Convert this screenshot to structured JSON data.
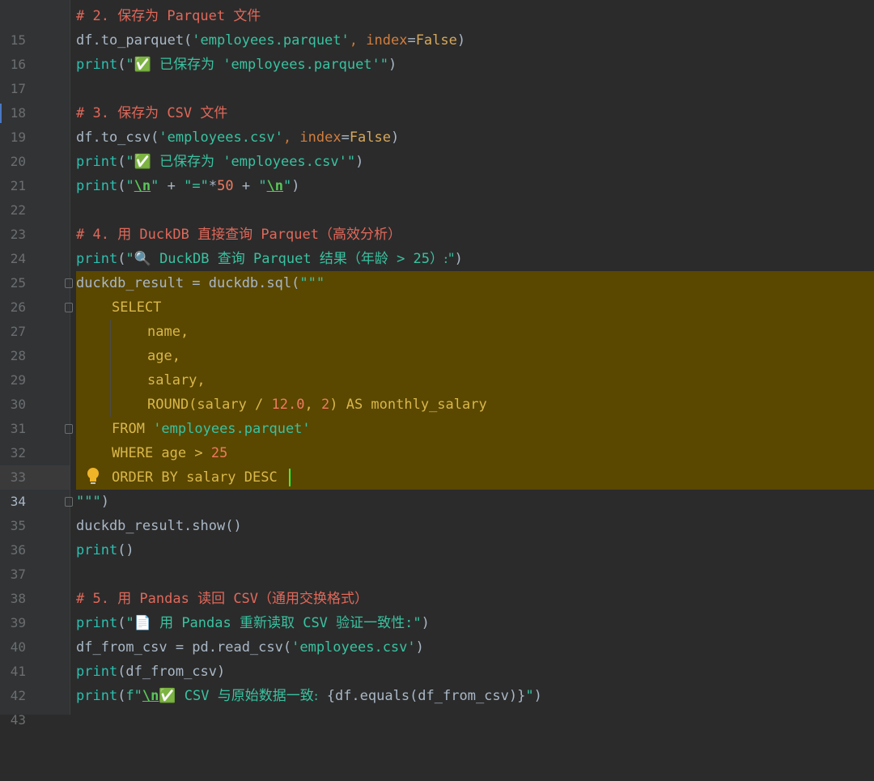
{
  "editor": {
    "current_line": "34",
    "lines": [
      {
        "n": "15",
        "text": "# 2. 保存为 Parquet 文件"
      },
      {
        "n": "16",
        "text": "df.to_parquet('employees.parquet', index=False)"
      },
      {
        "n": "17",
        "text": "print(\"✅ 已保存为 'employees.parquet'\")"
      },
      {
        "n": "18",
        "text": ""
      },
      {
        "n": "19",
        "text": "# 3. 保存为 CSV 文件"
      },
      {
        "n": "20",
        "text": "df.to_csv('employees.csv', index=False)"
      },
      {
        "n": "21",
        "text": "print(\"✅ 已保存为 'employees.csv'\")"
      },
      {
        "n": "22",
        "text": "print(\"\\n\" + \"=\"*50 + \"\\n\")"
      },
      {
        "n": "23",
        "text": ""
      },
      {
        "n": "24",
        "text": "# 4. 用 DuckDB 直接查询 Parquet（高效分析）"
      },
      {
        "n": "25",
        "text": "print(\"🔍 DuckDB 查询 Parquet 结果（年龄 > 25）:\")"
      },
      {
        "n": "26",
        "text": "duckdb_result = duckdb.sql(\"\"\""
      },
      {
        "n": "27",
        "text": "    SELECT"
      },
      {
        "n": "28",
        "text": "        name,"
      },
      {
        "n": "29",
        "text": "        age,"
      },
      {
        "n": "30",
        "text": "        salary,"
      },
      {
        "n": "31",
        "text": "        ROUND(salary / 12.0, 2) AS monthly_salary"
      },
      {
        "n": "32",
        "text": "    FROM 'employees.parquet'"
      },
      {
        "n": "33",
        "text": "    WHERE age > 25"
      },
      {
        "n": "34",
        "text": "    ORDER BY salary DESC"
      },
      {
        "n": "35",
        "text": "\"\"\")"
      },
      {
        "n": "36",
        "text": "duckdb_result.show()"
      },
      {
        "n": "37",
        "text": "print()"
      },
      {
        "n": "38",
        "text": ""
      },
      {
        "n": "39",
        "text": "# 5. 用 Pandas 读回 CSV（通用交换格式）"
      },
      {
        "n": "40",
        "text": "print(\"📄 用 Pandas 重新读取 CSV 验证一致性:\")"
      },
      {
        "n": "41",
        "text": "df_from_csv = pd.read_csv('employees.csv')"
      },
      {
        "n": "42",
        "text": "print(df_from_csv)"
      },
      {
        "n": "43",
        "text": "print(f\"\\n✅ CSV 与原始数据一致: {df.equals(df_from_csv)}\")"
      }
    ],
    "tokens": {
      "l15_a": "# 2. ",
      "l15_b": "保存为",
      "l15_c": " Parquet ",
      "l15_d": "文件",
      "l16_a": "df.to_parquet(",
      "l16_b": "'employees.parquet'",
      "l16_c": ", ",
      "l16_d": "index",
      "l16_e": "=",
      "l16_f": "False",
      "l16_g": ")",
      "l17_a": "print",
      "l17_b": "(",
      "l17_c": "\"✅ ",
      "l17_d": "已保存为",
      "l17_e": " 'employees.parquet'\"",
      "l17_f": ")",
      "l19_a": "# 3. ",
      "l19_b": "保存为",
      "l19_c": " CSV ",
      "l19_d": "文件",
      "l20_a": "df.to_csv(",
      "l20_b": "'employees.csv'",
      "l20_c": ", ",
      "l20_d": "index",
      "l20_e": "=",
      "l20_f": "False",
      "l20_g": ")",
      "l21_a": "print",
      "l21_b": "(",
      "l21_c": "\"✅ ",
      "l21_d": "已保存为",
      "l21_e": " 'employees.csv'\"",
      "l21_f": ")",
      "l22_a": "print",
      "l22_b": "(",
      "l22_c": "\"",
      "l22_d": "\\n",
      "l22_e": "\"",
      "l22_f": " + ",
      "l22_g": "\"=\"",
      "l22_h": "*",
      "l22_i": "50",
      "l22_j": " + ",
      "l22_k": "\"",
      "l22_l": "\\n",
      "l22_m": "\"",
      "l22_n": ")",
      "l24_a": "# 4. ",
      "l24_b": "用",
      "l24_c": " DuckDB ",
      "l24_d": "直接查询",
      "l24_e": " Parquet",
      "l24_f": "（高效分析）",
      "l25_a": "print",
      "l25_b": "(",
      "l25_c": "\"🔍 DuckDB ",
      "l25_d": "查询",
      "l25_e": " Parquet ",
      "l25_f": "结果（年龄",
      "l25_g": " > 25",
      "l25_h": "）:\"",
      "l25_i": ")",
      "l26_a": "duckdb_result = duckdb.sql(",
      "l26_b": "\"\"\"",
      "l27_a": "SELECT",
      "l28_a": "name,",
      "l29_a": "age,",
      "l30_a": "salary,",
      "l31_a": "ROUND(salary / ",
      "l31_b": "12.0",
      "l31_c": ", ",
      "l31_d": "2",
      "l31_e": ") ",
      "l31_f": "AS",
      "l31_g": " monthly_salary",
      "l32_a": "FROM ",
      "l32_b": "'employees.parquet'",
      "l33_a": "WHERE ",
      "l33_b": "age > ",
      "l33_c": "25",
      "l34_a": "ORDER BY ",
      "l34_b": "salary ",
      "l34_c": "DESC",
      "l35_a": "\"\"\"",
      "l35_b": ")",
      "l36_a": "duckdb_result.show()",
      "l37_a": "print",
      "l37_b": "()",
      "l39_a": "# 5. ",
      "l39_b": "用",
      "l39_c": " Pandas ",
      "l39_d": "读回",
      "l39_e": " CSV",
      "l39_f": "（通用交换格式）",
      "l40_a": "print",
      "l40_b": "(",
      "l40_c": "\"📄 ",
      "l40_d": "用",
      "l40_e": " Pandas ",
      "l40_f": "重新读取",
      "l40_g": " CSV ",
      "l40_h": "验证一致性",
      "l40_i": ":\"",
      "l40_j": ")",
      "l41_a": "df_from_csv = pd.read_csv(",
      "l41_b": "'employees.csv'",
      "l41_c": ")",
      "l42_a": "print",
      "l42_b": "(df_from_csv)",
      "l43_a": "print",
      "l43_b": "(",
      "l43_c": "f\"",
      "l43_d": "\\n",
      "l43_e": "✅ CSV ",
      "l43_f": "与原始数据一致:",
      "l43_g": " {df.equals(df_from_csv)}",
      "l43_h": "\"",
      "l43_i": ")"
    }
  }
}
